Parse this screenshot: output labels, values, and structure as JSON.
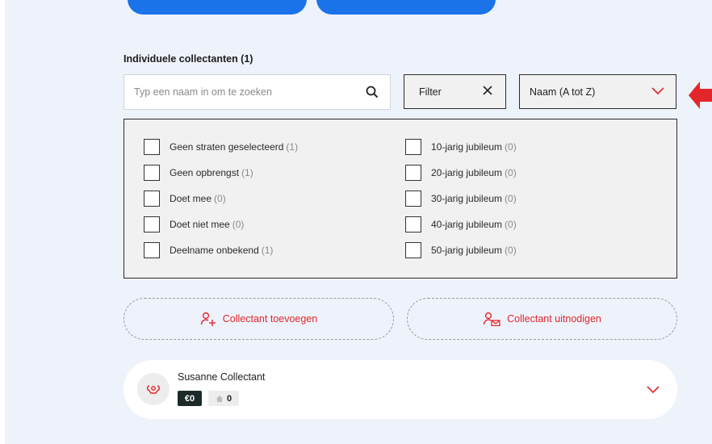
{
  "section": {
    "title": "Individuele collectanten (1)"
  },
  "search": {
    "placeholder": "Typ een naam in om te zoeken",
    "icon": "search-icon"
  },
  "filter": {
    "label": "Filter",
    "clear_icon": "close-icon"
  },
  "sort": {
    "selected": "Naam (A tot Z)",
    "icon": "chevron-down-icon"
  },
  "checkboxes": {
    "left": [
      {
        "label": "Geen straten geselecteerd",
        "count": "(1)"
      },
      {
        "label": "Geen opbrengst",
        "count": "(1)"
      },
      {
        "label": "Doet mee",
        "count": "(0)"
      },
      {
        "label": "Doet niet mee",
        "count": "(0)"
      },
      {
        "label": "Deelname onbekend",
        "count": "(1)"
      }
    ],
    "right": [
      {
        "label": "10-jarig jubileum",
        "count": "(0)"
      },
      {
        "label": "20-jarig jubileum",
        "count": "(0)"
      },
      {
        "label": "30-jarig jubileum",
        "count": "(0)"
      },
      {
        "label": "40-jarig jubileum",
        "count": "(0)"
      },
      {
        "label": "50-jarig jubileum",
        "count": "(0)"
      }
    ]
  },
  "actions": {
    "add": "Collectant toevoegen",
    "invite": "Collectant uitnodigen"
  },
  "collectant": {
    "name": "Susanne Collectant",
    "money_badge": "€0",
    "house_count": "0"
  },
  "colors": {
    "accent": "#e3262b",
    "primary": "#1a73e8",
    "panel_bg": "#eef2fb"
  }
}
